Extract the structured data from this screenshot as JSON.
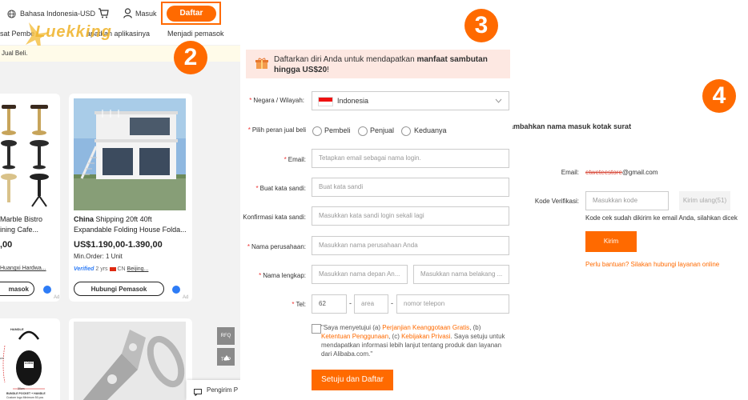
{
  "header": {
    "truncated_link": "sat Pembe",
    "language_currency": "Bahasa Indonesia-USD",
    "login_label": "Masuk",
    "register_label": "Daftar",
    "app_link": "apatkan aplikasinya",
    "become_supplier": "Menjadi pemasok",
    "watermark_text": "Luekking",
    "banner_text": "Jual Beli."
  },
  "steps": {
    "step2": "2",
    "step3": "3",
    "step4": "4"
  },
  "products": [
    {
      "title_line1": "Marble Bistro",
      "title_line2": "ining Cafe...",
      "price": ",00",
      "supplier": "Huangxi Hardwa...",
      "contact_label": "masok",
      "ad_label": "Ad"
    },
    {
      "title_bold": "China",
      "title_line1": "Shipping 20ft 40ft",
      "title_line2": "Expandable Folding House Folda...",
      "price": "US$1.190,00-1.390,00",
      "min_order": "Min.Order: 1 Unit",
      "verified": "Verified",
      "years": "2 yrs",
      "country": "CN",
      "supplier": "Beijing...",
      "contact_label": "Hubungi Pemasok",
      "ad_label": "Ad"
    }
  ],
  "bag_labels": {
    "handle": "HANDLE",
    "logo": "LOGO",
    "size1": "30cm",
    "size2": "35cm",
    "caption1": "BUNDLE POCKET + HANDLE",
    "caption2": "Custom logo Minimum 50 pcs"
  },
  "side_tools": {
    "rfq": "RFQ",
    "top": "TOP"
  },
  "sender_label": "Pengirim P",
  "registration": {
    "promo_text": "Daftarkan diri Anda untuk mendapatkan",
    "promo_bold": "manfaat sambutan hingga US$20",
    "promo_end": "!",
    "country_label": "Negara / Wilayah:",
    "country_value": "Indonesia",
    "role_label": "Pilih peran jual beli",
    "role_options": [
      "Pembeli",
      "Penjual",
      "Keduanya"
    ],
    "email_label": "Email:",
    "email_placeholder": "Tetapkan email sebagai nama login.",
    "password_label": "Buat kata sandi:",
    "password_placeholder": "Buat kata sandi",
    "confirm_label": "Konfirmasi kata sandi:",
    "confirm_placeholder": "Masukkan kata sandi login sekali lagi",
    "company_label": "Nama perusahaan:",
    "company_placeholder": "Masukkan nama perusahaan Anda",
    "fullname_label": "Nama lengkap:",
    "firstname_placeholder": "Masukkan nama depan An...",
    "lastname_placeholder": "Masukkan nama belakang ...",
    "phone_label": "Tel:",
    "phone_code": "62",
    "area_placeholder": "area",
    "phone_placeholder": "nomor telepon",
    "dash": "-",
    "agree_prefix": "\"Saya menyetujui (a)",
    "agree_link1": "Perjanjian Keanggotaan Gratis",
    "agree_mid1": ", (b)",
    "agree_link2": "Ketentuan Penggunaan",
    "agree_mid2": ", (c)",
    "agree_link3": "Kebijakan Privasi",
    "agree_rest": ". Saya setuju untuk mendapatkan informasi lebih lanjut tentang produk dan layanan dari Alibaba.com.\"",
    "submit_label": "Setuju dan Daftar"
  },
  "verification": {
    "heading": "ambahkan nama masuk kotak surat",
    "email_label": "Email:",
    "email_value_prefix": "etweteestore",
    "email_value_domain": "@gmail.com",
    "code_label": "Kode Verifikasi:",
    "code_placeholder": "Masukkan kode",
    "resend_label": "Kirim ulang(51)",
    "sent_note": "Kode cek sudah dikirim ke email Anda, silahkan dicek",
    "send_label": "Kirim",
    "help_text": "Perlu bantuan? Silakan hubungi layanan online"
  },
  "colors": {
    "accent": "#ff6a00",
    "promo_bg": "#fde8e2",
    "verified_blue": "#2e7cf6"
  }
}
